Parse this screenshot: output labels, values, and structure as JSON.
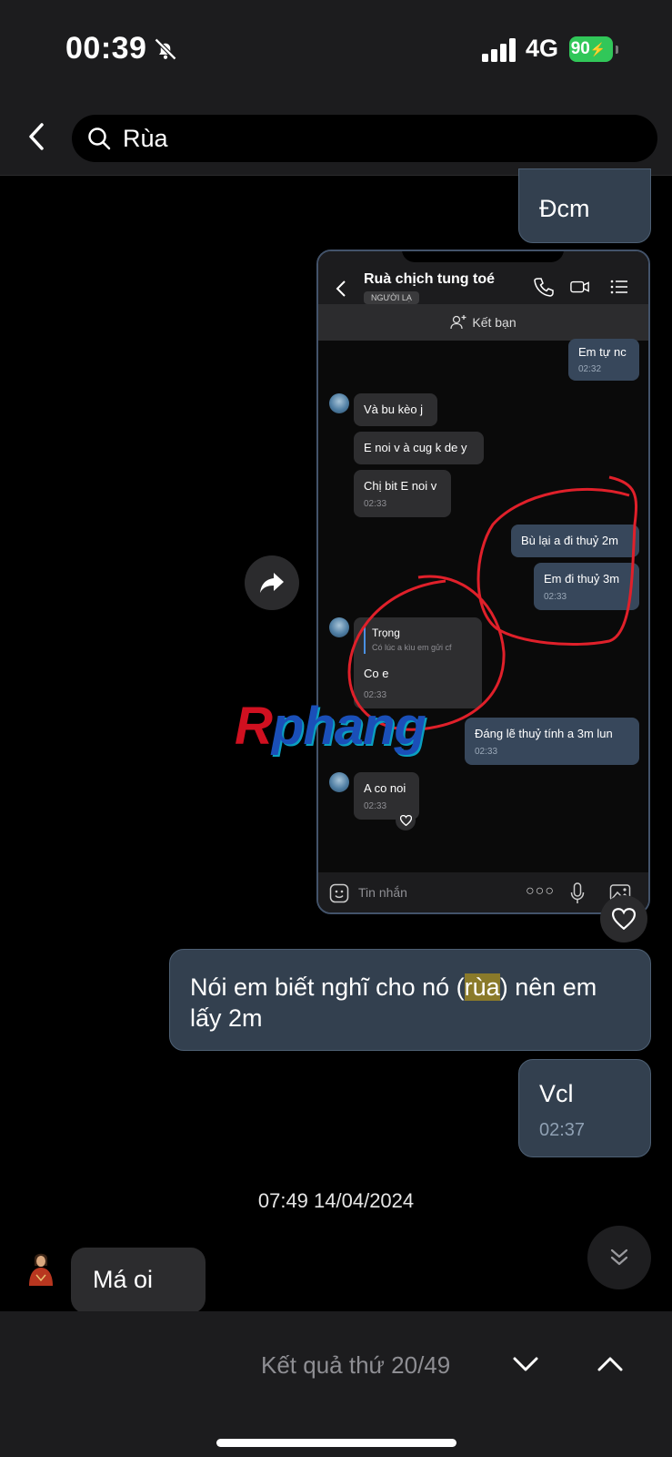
{
  "status_bar": {
    "time": "00:39",
    "network": "4G",
    "battery": "90"
  },
  "search": {
    "query": "Rùa"
  },
  "messages": {
    "m1": "Đcm",
    "m3_before": "Nói em biết nghĩ cho nó (",
    "m3_highlight": "rùa",
    "m3_after": ") nên em lấy 2m",
    "m4_text": "Vcl",
    "m4_time": "02:37",
    "date": "07:49 14/04/2024",
    "m5_text": "Má oi"
  },
  "screenshot": {
    "title": "Ruà chịch tung toé",
    "badge": "NGƯỜI LẠ",
    "add_friend": "Kết bạn",
    "o1_text": "Em tự nc",
    "o1_time": "02:32",
    "i1": "Và bu kèo j",
    "i2": "E noi v à cug k de y",
    "i3_text": "Chị bit E noi v",
    "i3_time": "02:33",
    "o2": "Bù lại a đi thuỷ 2m",
    "o3_text": "Em đi thuỷ 3m",
    "o3_time": "02:33",
    "reply_name": "Trọng",
    "reply_quote": "Có lúc a kìu em gửi cf",
    "i4_text": "Co e",
    "i4_time": "02:33",
    "o4_text": "Đáng lẽ thuỷ tính a 3m lun",
    "o4_time": "02:33",
    "i5_text": "A co noi",
    "i5_time": "02:33",
    "input_placeholder": "Tin nhắn"
  },
  "watermark": {
    "first": "R",
    "rest": "phang"
  },
  "bottom": {
    "result": "Kết quả thứ 20/49"
  },
  "colors": {
    "outgoing_bubble": "#33404f",
    "incoming_bubble": "#2c2c2e",
    "highlight": "#8a7a2a",
    "battery": "#31c759",
    "annotation": "#e0202a"
  }
}
